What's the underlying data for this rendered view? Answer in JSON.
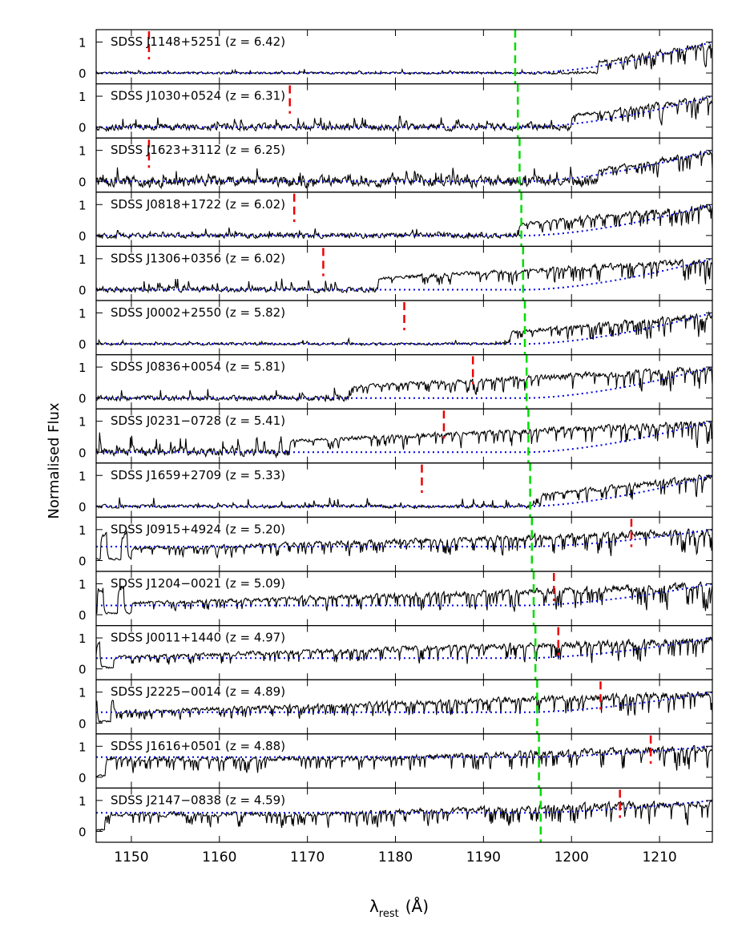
{
  "chart_data": {
    "type": "line",
    "xlabel": "λ",
    "xlabel_sub": "rest",
    "xlabel_unit": "(Å)",
    "ylabel": "Normalised Flux",
    "xlim": [
      1146,
      1216
    ],
    "xticks": [
      1150,
      1160,
      1170,
      1180,
      1190,
      1200,
      1210
    ],
    "ylim": [
      -0.35,
      1.4
    ],
    "yticks": [
      0,
      1
    ],
    "colors": {
      "flux": "#000000",
      "continuum": "#0000dd",
      "red_marker": "#ee0000",
      "green_marker": "#00dd00"
    },
    "panels": [
      {
        "label": "SDSS J1148+5251 (z = 6.42)",
        "red_x": 1152.0,
        "green_x": 1193.6,
        "cont_start": 0.0,
        "emit_start": 1203.0,
        "noise": 0.05,
        "spike": 0.15
      },
      {
        "label": "SDSS J1030+0524 (z = 6.31)",
        "red_x": 1168.0,
        "green_x": 1193.9,
        "cont_start": 0.0,
        "emit_start": 1200.0,
        "noise": 0.15,
        "spike": 0.5
      },
      {
        "label": "SDSS J1623+3112 (z = 6.25)",
        "red_x": 1152.0,
        "green_x": 1194.1,
        "cont_start": 0.0,
        "emit_start": 1203.0,
        "noise": 0.25,
        "spike": 0.6
      },
      {
        "label": "SDSS J0818+1722 (z = 6.02)",
        "red_x": 1168.5,
        "green_x": 1194.3,
        "cont_start": 0.0,
        "emit_start": 1194.0,
        "noise": 0.12,
        "spike": 0.35
      },
      {
        "label": "SDSS J1306+0356 (z = 6.02)",
        "red_x": 1171.8,
        "green_x": 1194.5,
        "cont_start": 0.0,
        "emit_start": 1178.0,
        "noise": 0.12,
        "spike": 0.7
      },
      {
        "label": "SDSS J0002+2550 (z = 5.82)",
        "red_x": 1181.0,
        "green_x": 1194.7,
        "cont_start": 0.0,
        "emit_start": 1193.0,
        "noise": 0.06,
        "spike": 0.2
      },
      {
        "label": "SDSS J0836+0054 (z = 5.81)",
        "red_x": 1188.8,
        "green_x": 1194.9,
        "cont_start": 0.0,
        "emit_start": 1175.0,
        "noise": 0.12,
        "spike": 0.6
      },
      {
        "label": "SDSS J0231−0728 (z = 5.41)",
        "red_x": 1185.5,
        "green_x": 1195.1,
        "cont_start": 0.0,
        "emit_start": 1168.0,
        "noise": 0.2,
        "spike": 0.9
      },
      {
        "label": "SDSS J1659+2709 (z = 5.33)",
        "red_x": 1183.0,
        "green_x": 1195.3,
        "cont_start": 0.0,
        "emit_start": 1196.0,
        "noise": 0.08,
        "spike": 0.5
      },
      {
        "label": "SDSS J0915+4924 (z = 5.20)",
        "red_x": 1206.8,
        "green_x": 1195.5,
        "cont_start": 0.45,
        "emit_start": 1150.0,
        "noise": 0.2,
        "spike": 0.7
      },
      {
        "label": "SDSS J1204−0021 (z = 5.09)",
        "red_x": 1198.0,
        "green_x": 1195.7,
        "cont_start": 0.3,
        "emit_start": 1150.0,
        "noise": 0.2,
        "spike": 0.7
      },
      {
        "label": "SDSS J0011+1440 (z = 4.97)",
        "red_x": 1198.5,
        "green_x": 1195.9,
        "cont_start": 0.35,
        "emit_start": 1148.0,
        "noise": 0.25,
        "spike": 0.8
      },
      {
        "label": "SDSS J2225−0014 (z = 4.89)",
        "red_x": 1203.3,
        "green_x": 1196.1,
        "cont_start": 0.35,
        "emit_start": 1148.0,
        "noise": 0.25,
        "spike": 0.8
      },
      {
        "label": "SDSS J1616+0501 (z = 4.88)",
        "red_x": 1209.0,
        "green_x": 1196.3,
        "cont_start": 0.65,
        "emit_start": 1147.0,
        "noise": 0.3,
        "spike": 0.8
      },
      {
        "label": "SDSS J2147−0838 (z = 4.59)",
        "red_x": 1205.5,
        "green_x": 1196.5,
        "cont_start": 0.6,
        "emit_start": 1147.0,
        "noise": 0.3,
        "spike": 0.8
      }
    ]
  }
}
